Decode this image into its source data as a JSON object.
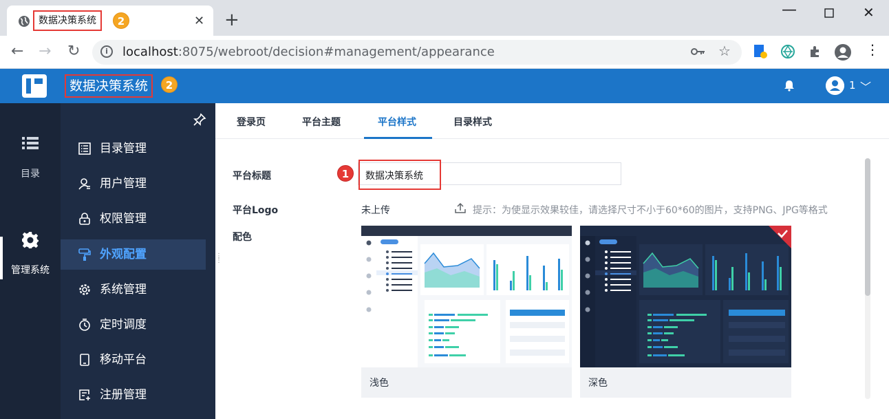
{
  "browser": {
    "tab_title": "数据决策系统",
    "tab_badge": "2",
    "url_host": "localhost",
    "url_rest": ":8075/webroot/decision#management/appearance"
  },
  "app": {
    "title": "数据决策系统",
    "title_badge": "2",
    "user_name": "1",
    "brand_color": "#1c75c8"
  },
  "rail": {
    "items": [
      {
        "label": "目录",
        "icon": "list-icon"
      },
      {
        "label": "管理系统",
        "icon": "gear-icon"
      }
    ]
  },
  "menu": {
    "items": [
      {
        "label": "目录管理",
        "icon": "catalog-icon"
      },
      {
        "label": "用户管理",
        "icon": "user-icon"
      },
      {
        "label": "权限管理",
        "icon": "lock-icon"
      },
      {
        "label": "外观配置",
        "icon": "paint-roller-icon",
        "active": true
      },
      {
        "label": "系统管理",
        "icon": "settings-icon"
      },
      {
        "label": "定时调度",
        "icon": "timer-icon"
      },
      {
        "label": "移动平台",
        "icon": "mobile-icon"
      },
      {
        "label": "注册管理",
        "icon": "register-icon"
      }
    ]
  },
  "tabs": [
    {
      "label": "登录页"
    },
    {
      "label": "平台主题"
    },
    {
      "label": "平台样式",
      "active": true
    },
    {
      "label": "目录样式"
    }
  ],
  "form": {
    "title_label": "平台标题",
    "title_value": "数据决策系统",
    "title_badge": "1",
    "logo_label": "平台Logo",
    "logo_status": "未上传",
    "logo_hint": "提示：为使显示效果较佳，请选择尺寸不小于60*60的图片，支持PNG、JPG等格式",
    "color_label": "配色",
    "themes": [
      {
        "name": "浅色",
        "selected": false
      },
      {
        "name": "深色",
        "selected": true
      }
    ]
  }
}
